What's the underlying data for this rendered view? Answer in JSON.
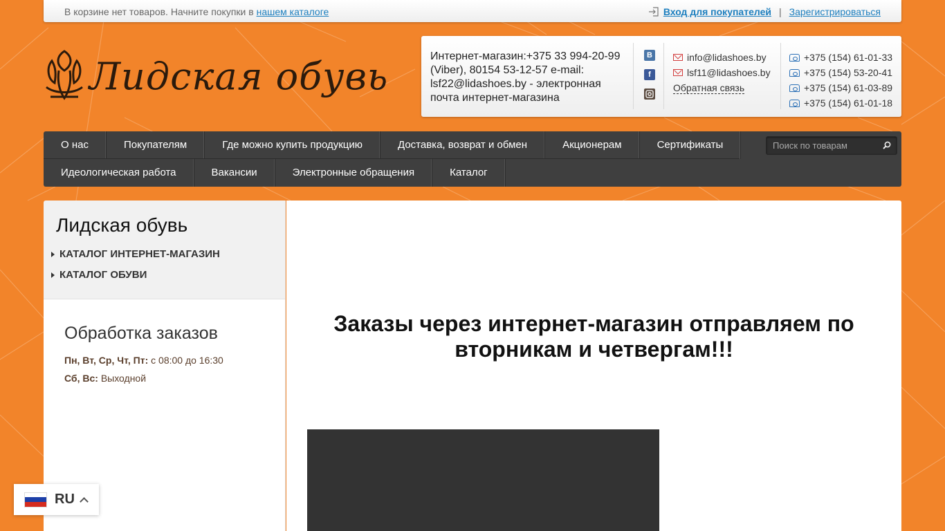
{
  "topbar": {
    "cart_text": "В корзине нет товаров. Начните покупки в",
    "catalog_link": "нашем каталоге",
    "login": "Вход для покупателей",
    "separator": "|",
    "register": "Зарегистрироваться"
  },
  "logo": {
    "text": "Лидская обувь"
  },
  "contacts": {
    "shop_info": "Интернет-магазин:+375 33 994-20-99 (Viber), 80154 53-12-57 e-mail: lsf22@lidashoes.by - электронная почта интернет-магазина",
    "social": {
      "vk": "B"
    },
    "emails": [
      "info@lidashoes.by",
      "lsf11@lidashoes.by"
    ],
    "feedback": "Обратная связь",
    "phones": [
      "+375 (154) 61-01-33",
      "+375 (154) 53-20-41",
      "+375 (154) 61-03-89",
      "+375 (154) 61-01-18"
    ]
  },
  "nav": {
    "row1": [
      "О нас",
      "Покупателям",
      "Где можно купить продукцию",
      "Доставка, возврат и обмен",
      "Акционерам",
      "Сертификаты"
    ],
    "row2": [
      "Идеологическая работа",
      "Вакансии",
      "Электронные обращения",
      "Каталог"
    ],
    "search_placeholder": "Поиск по товарам"
  },
  "sidebar": {
    "title": "Лидская обувь",
    "categories": [
      "КАТАЛОГ ИНТЕРНЕТ-МАГАЗИН",
      "КАТАЛОГ ОБУВИ"
    ],
    "hours_title": "Обработка заказов",
    "hours": [
      {
        "days": "Пн, Вт, Ср, Чт, Пт:",
        "time": "с 08:00 до 16:30"
      },
      {
        "days": "Сб, Вс:",
        "time": "Выходной"
      }
    ]
  },
  "main": {
    "notice": "Заказы через интернет-магазин отправляем по вторникам и четвергам!!!"
  },
  "language": {
    "code": "RU"
  },
  "colors": {
    "background": "#f2842a",
    "nav": "#3f3f3f",
    "link": "#1d7fbf"
  }
}
